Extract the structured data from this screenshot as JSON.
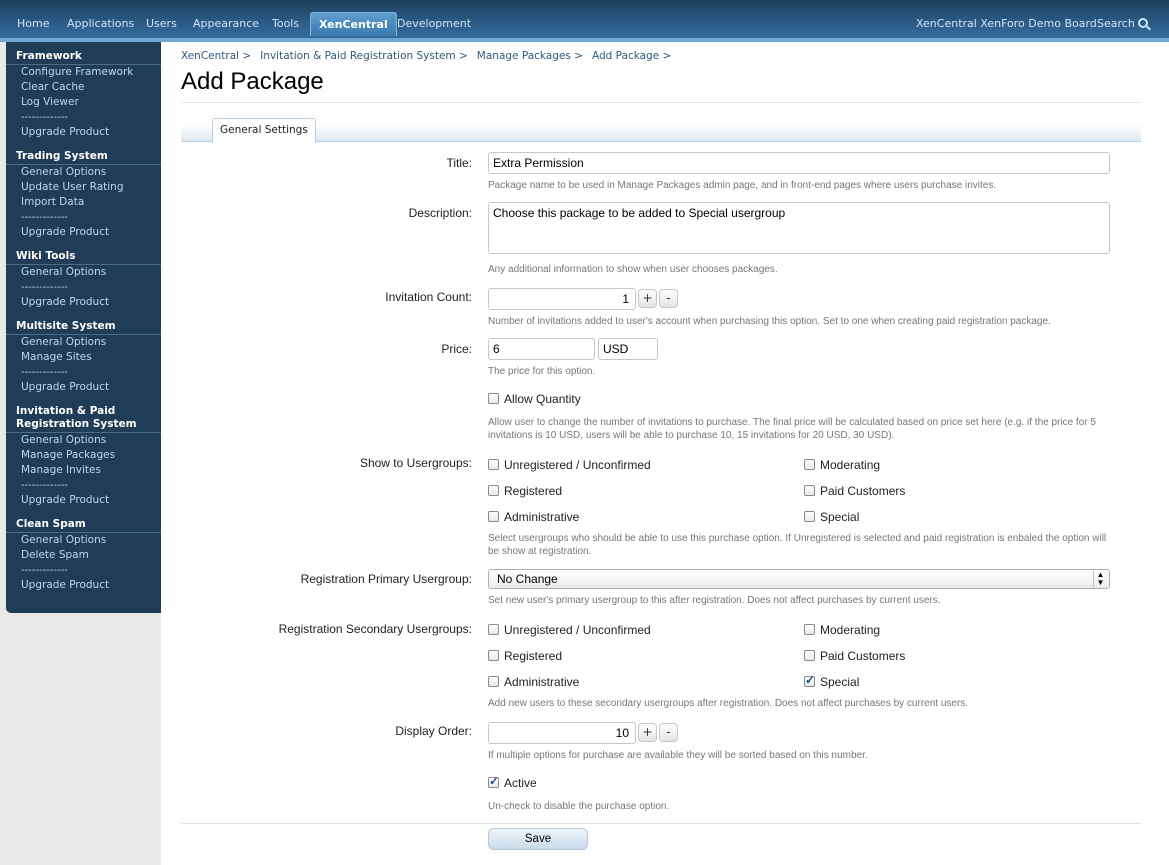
{
  "nav": {
    "tabs": [
      "Home",
      "Applications",
      "Users",
      "Appearance",
      "Tools",
      "XenCentral",
      "Development"
    ],
    "active_tab": "XenCentral",
    "board_name": "XenCentral XenForo Demo Board",
    "search_label": "Search"
  },
  "sidebar": {
    "groups": [
      {
        "title": "Framework",
        "items": [
          "Configure Framework",
          "Clear Cache",
          "Log Viewer",
          "-------------",
          "Upgrade Product"
        ]
      },
      {
        "title": "Trading System",
        "items": [
          "General Options",
          "Update User Rating",
          "Import Data",
          "-------------",
          "Upgrade Product"
        ]
      },
      {
        "title": "Wiki Tools",
        "items": [
          "General Options",
          "-------------",
          "Upgrade Product"
        ]
      },
      {
        "title": "Multisite System",
        "items": [
          "General Options",
          "Manage Sites",
          "-------------",
          "Upgrade Product"
        ]
      },
      {
        "title_line1": "Invitation & Paid",
        "title_line2": "Registration System",
        "items": [
          "General Options",
          "Manage Packages",
          "Manage Invites",
          "-------------",
          "Upgrade Product"
        ]
      },
      {
        "title": "Clean Spam",
        "items": [
          "General Options",
          "Delete Spam",
          "-------------",
          "Upgrade Product"
        ]
      }
    ]
  },
  "breadcrumb": [
    "XenCentral >",
    "Invitation & Paid Registration System >",
    "Manage Packages >",
    "Add Package >"
  ],
  "page_title": "Add Package",
  "tab_label": "General Settings",
  "form": {
    "title": {
      "label": "Title:",
      "value": "Extra Permission",
      "hint": "Package name to be used in Manage Packages admin page, and in front-end pages where users purchase invites."
    },
    "description": {
      "label": "Description:",
      "value": "Choose this package to be added to Special usergroup",
      "hint": "Any additional information to show when user chooses packages."
    },
    "invitation_count": {
      "label": "Invitation Count:",
      "value": "1",
      "hint": "Number of invitations added to user's account when purchasing this option. Set to one when creating paid registration package."
    },
    "price": {
      "label": "Price:",
      "value": "6",
      "currency": "USD",
      "hint": "The price for this option."
    },
    "allow_quantity": {
      "label": "Allow Quantity",
      "checked": false,
      "hint": "Allow user to change the number of invitations to purchase. The final price will be calculated based on price set here (e.g. if the price for 5 invitations is 10 USD, users will be able to purchase 10, 15 invitations for 20 USD, 30 USD)."
    },
    "show_groups": {
      "label": "Show to Usergroups:",
      "options": [
        {
          "name": "Unregistered / Unconfirmed",
          "checked": false
        },
        {
          "name": "Registered",
          "checked": false
        },
        {
          "name": "Administrative",
          "checked": false
        },
        {
          "name": "Moderating",
          "checked": false
        },
        {
          "name": "Paid Customers",
          "checked": false
        },
        {
          "name": "Special",
          "checked": false
        }
      ],
      "hint": "Select usergroups who should be able to use this purchase option. If Unregistered is selected and paid registration is enbaled the option will be show at registration."
    },
    "primary_group": {
      "label": "Registration Primary Usergroup:",
      "value": "No Change",
      "hint": "Set new user's primary usergroup to this after registration. Does not affect purchases by current users."
    },
    "secondary_groups": {
      "label": "Registration Secondary Usergroups:",
      "options": [
        {
          "name": "Unregistered / Unconfirmed",
          "checked": false
        },
        {
          "name": "Registered",
          "checked": false
        },
        {
          "name": "Administrative",
          "checked": false
        },
        {
          "name": "Moderating",
          "checked": false
        },
        {
          "name": "Paid Customers",
          "checked": false
        },
        {
          "name": "Special",
          "checked": true
        }
      ],
      "hint": "Add new users to these secondary usergroups after registration. Does not affect purchases by current users."
    },
    "display_order": {
      "label": "Display Order:",
      "value": "10",
      "hint": "If multiple options for purchase are available they will be sorted based on this number."
    },
    "active": {
      "label": "Active",
      "checked": true,
      "hint": "Un-check to disable the purchase option."
    },
    "plus": "+",
    "minus": "-",
    "save_label": "Save"
  }
}
